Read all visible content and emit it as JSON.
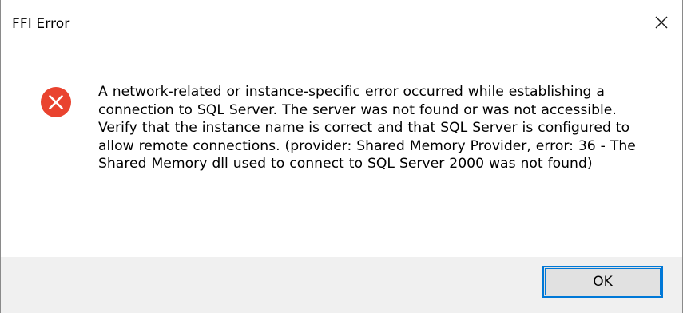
{
  "window": {
    "title": "FFI Error"
  },
  "titlebar": {
    "close_icon": "close-icon"
  },
  "body": {
    "icon": "error-icon",
    "icon_color": "#e81123",
    "message": "A network-related or instance-specific error occurred while establishing a connection to SQL Server. The server was not found or was not accessible. Verify that the instance name is correct and that SQL Server is configured to allow remote connections. (provider: Shared Memory Provider, error: 36 - The Shared Memory dll used to connect to SQL Server 2000 was not found)"
  },
  "footer": {
    "ok_label": "OK",
    "accent": "#0078d7"
  }
}
